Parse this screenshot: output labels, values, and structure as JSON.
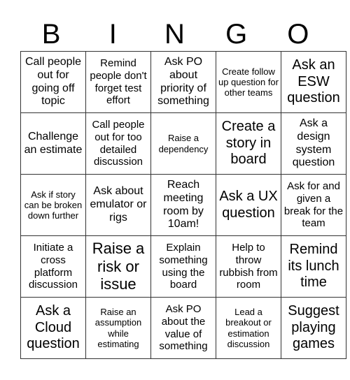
{
  "header": {
    "letters": [
      "B",
      "I",
      "N",
      "G",
      "O"
    ]
  },
  "rows": [
    [
      "Call people out for going off topic",
      "Remind people don't forget test effort",
      "Ask PO about priority of something",
      "Create follow up question for other teams",
      "Ask an ESW question"
    ],
    [
      "Challenge an estimate",
      "Call people out for too detailed discussion",
      "Raise a dependency",
      "Create a story in board",
      "Ask a design system question"
    ],
    [
      "Ask if story can be broken down further",
      "Ask about emulator or rigs",
      "Reach meeting room by 10am!",
      "Ask a UX question",
      "Ask for and given a break for the team"
    ],
    [
      "Initiate a cross platform discussion",
      "Raise a risk or issue",
      "Explain something using the board",
      "Help to throw rubbish from room",
      "Remind its lunch time"
    ],
    [
      "Ask a Cloud question",
      "Raise an assumption while estimating",
      "Ask PO about the value of something",
      "Lead a breakout or estimation discussion",
      "Suggest playing games"
    ]
  ]
}
